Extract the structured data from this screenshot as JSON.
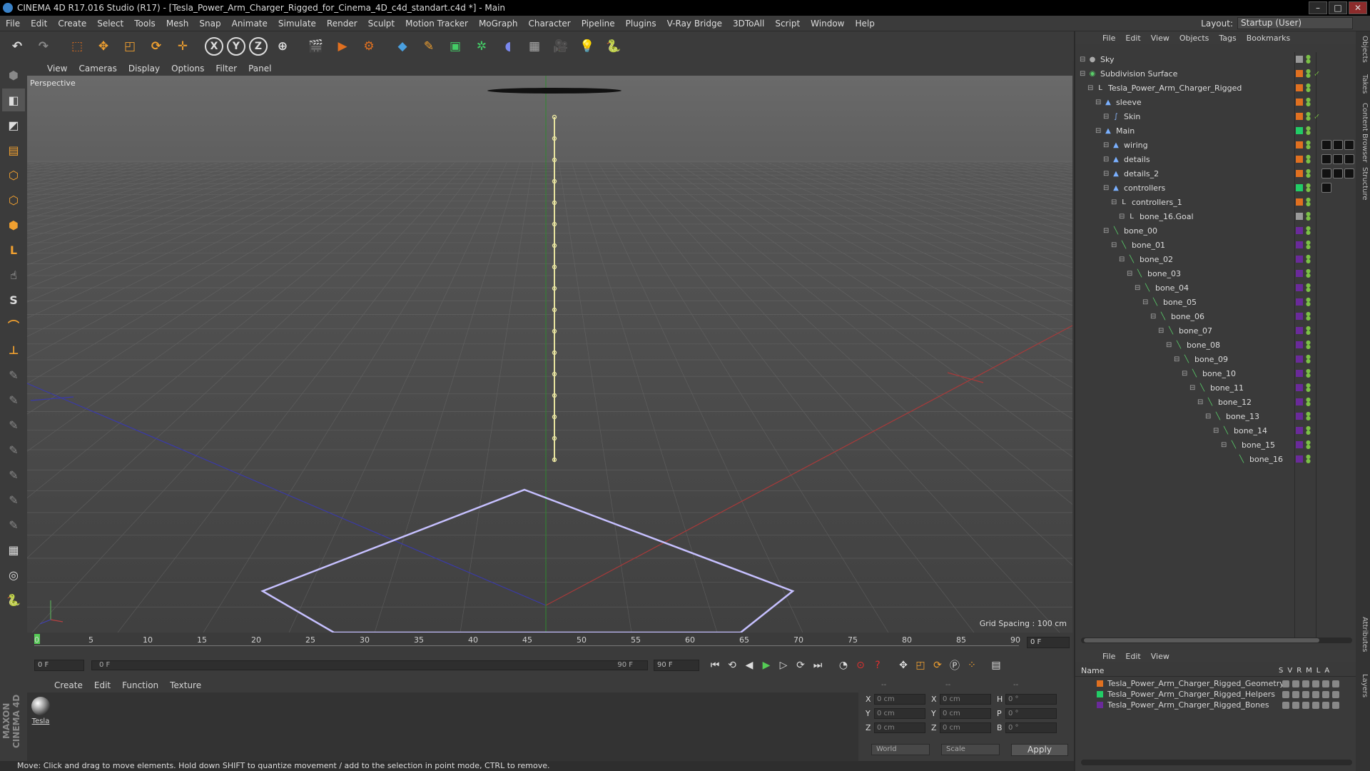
{
  "window": {
    "title": "CINEMA 4D R17.016 Studio (R17) - [Tesla_Power_Arm_Charger_Rigged_for_Cinema_4D_c4d_standart.c4d *] - Main"
  },
  "menubar": [
    "File",
    "Edit",
    "Create",
    "Select",
    "Tools",
    "Mesh",
    "Snap",
    "Animate",
    "Simulate",
    "Render",
    "Sculpt",
    "Motion Tracker",
    "MoGraph",
    "Character",
    "Pipeline",
    "Plugins",
    "V-Ray Bridge",
    "3DToAll",
    "Script",
    "Window",
    "Help"
  ],
  "layout": {
    "label": "Layout:",
    "value": "Startup (User)"
  },
  "viewport": {
    "menu": [
      "View",
      "Cameras",
      "Display",
      "Options",
      "Filter",
      "Panel"
    ],
    "camera_label": "Perspective",
    "grid_spacing": "Grid Spacing : 100 cm"
  },
  "timeline": {
    "ticks": [
      "0",
      "5",
      "10",
      "15",
      "20",
      "25",
      "30",
      "35",
      "40",
      "45",
      "50",
      "55",
      "60",
      "65",
      "70",
      "75",
      "80",
      "85",
      "90"
    ],
    "current_frame": "0 F",
    "start_frame": "0 F",
    "range_start": "0 F",
    "range_end": "90 F",
    "end_frame": "90 F"
  },
  "material_panel": {
    "menu": [
      "Create",
      "Edit",
      "Function",
      "Texture"
    ],
    "materials": [
      {
        "name": "Tesla"
      }
    ]
  },
  "attributes": {
    "rows": [
      {
        "l1": "X",
        "v1": "0 cm",
        "l2": "X",
        "v2": "0 cm",
        "l3": "H",
        "v3": "0 °"
      },
      {
        "l1": "Y",
        "v1": "0 cm",
        "l2": "Y",
        "v2": "0 cm",
        "l3": "P",
        "v3": "0 °"
      },
      {
        "l1": "Z",
        "v1": "0 cm",
        "l2": "Z",
        "v2": "0 cm",
        "l3": "B",
        "v3": "0 °"
      }
    ],
    "coord_dropdown": "World",
    "mode_dropdown": "Scale",
    "apply_label": "Apply",
    "header_dashes": "--"
  },
  "status_text": "Move: Click and drag to move elements. Hold down SHIFT to quantize movement / add to the selection in point mode, CTRL to remove.",
  "object_manager": {
    "menu": [
      "File",
      "Edit",
      "View",
      "Objects",
      "Tags",
      "Bookmarks"
    ],
    "objects": [
      {
        "name": "Sky",
        "depth": 0,
        "icon": "sky-icon",
        "color": "#999999"
      },
      {
        "name": "Subdivision Surface",
        "depth": 0,
        "icon": "subdivision-icon",
        "color": "#e07020",
        "check": true
      },
      {
        "name": "Tesla_Power_Arm_Charger_Rigged",
        "depth": 1,
        "icon": "null-icon",
        "color": "#e07020"
      },
      {
        "name": "sleeve",
        "depth": 2,
        "icon": "polygon-icon",
        "color": "#e07020"
      },
      {
        "name": "Skin",
        "depth": 3,
        "icon": "skin-icon",
        "color": "#e07020",
        "check": true
      },
      {
        "name": "Main",
        "depth": 2,
        "icon": "polygon-icon",
        "color": "#22cc66"
      },
      {
        "name": "wiring",
        "depth": 3,
        "icon": "polygon-icon",
        "color": "#e07020",
        "tags": 3
      },
      {
        "name": "details",
        "depth": 3,
        "icon": "polygon-icon",
        "color": "#e07020",
        "tags": 3
      },
      {
        "name": "details_2",
        "depth": 3,
        "icon": "polygon-icon",
        "color": "#e07020",
        "tags": 3
      },
      {
        "name": "controllers",
        "depth": 3,
        "icon": "polygon-icon",
        "color": "#22cc66",
        "tags": 1
      },
      {
        "name": "controllers_1",
        "depth": 4,
        "icon": "null-icon",
        "color": "#e07020"
      },
      {
        "name": "bone_16.Goal",
        "depth": 5,
        "icon": "null-icon",
        "color": "#999999"
      },
      {
        "name": "bone_00",
        "depth": 3,
        "icon": "bone-icon",
        "color": "#6a2a9a"
      },
      {
        "name": "bone_01",
        "depth": 4,
        "icon": "bone-icon",
        "color": "#6a2a9a"
      },
      {
        "name": "bone_02",
        "depth": 5,
        "icon": "bone-icon",
        "color": "#6a2a9a"
      },
      {
        "name": "bone_03",
        "depth": 6,
        "icon": "bone-icon",
        "color": "#6a2a9a"
      },
      {
        "name": "bone_04",
        "depth": 7,
        "icon": "bone-icon",
        "color": "#6a2a9a"
      },
      {
        "name": "bone_05",
        "depth": 8,
        "icon": "bone-icon",
        "color": "#6a2a9a"
      },
      {
        "name": "bone_06",
        "depth": 9,
        "icon": "bone-icon",
        "color": "#6a2a9a"
      },
      {
        "name": "bone_07",
        "depth": 10,
        "icon": "bone-icon",
        "color": "#6a2a9a"
      },
      {
        "name": "bone_08",
        "depth": 11,
        "icon": "bone-icon",
        "color": "#6a2a9a"
      },
      {
        "name": "bone_09",
        "depth": 12,
        "icon": "bone-icon",
        "color": "#6a2a9a"
      },
      {
        "name": "bone_10",
        "depth": 13,
        "icon": "bone-icon",
        "color": "#6a2a9a"
      },
      {
        "name": "bone_11",
        "depth": 14,
        "icon": "bone-icon",
        "color": "#6a2a9a"
      },
      {
        "name": "bone_12",
        "depth": 15,
        "icon": "bone-icon",
        "color": "#6a2a9a"
      },
      {
        "name": "bone_13",
        "depth": 16,
        "icon": "bone-icon",
        "color": "#6a2a9a"
      },
      {
        "name": "bone_14",
        "depth": 17,
        "icon": "bone-icon",
        "color": "#6a2a9a"
      },
      {
        "name": "bone_15",
        "depth": 18,
        "icon": "bone-icon",
        "color": "#6a2a9a"
      },
      {
        "name": "bone_16",
        "depth": 19,
        "icon": "bone-icon",
        "color": "#6a2a9a"
      }
    ]
  },
  "layer_manager": {
    "menu": [
      "File",
      "Edit",
      "View"
    ],
    "header": "Name",
    "columns": [
      "S",
      "V",
      "R",
      "M",
      "L",
      "A"
    ],
    "layers": [
      {
        "name": "Tesla_Power_Arm_Charger_Rigged_Geometry",
        "color": "#e07020"
      },
      {
        "name": "Tesla_Power_Arm_Charger_Rigged_Helpers",
        "color": "#22cc66"
      },
      {
        "name": "Tesla_Power_Arm_Charger_Rigged_Bones",
        "color": "#6a2a9a"
      }
    ]
  },
  "side_tabs": [
    "Objects",
    "Takes",
    "Content Browser",
    "Structure",
    "Attributes",
    "Layers"
  ],
  "colors": {
    "bg": "#3a3a3a",
    "panel": "#3b3b3b",
    "accent": "#e07020"
  }
}
